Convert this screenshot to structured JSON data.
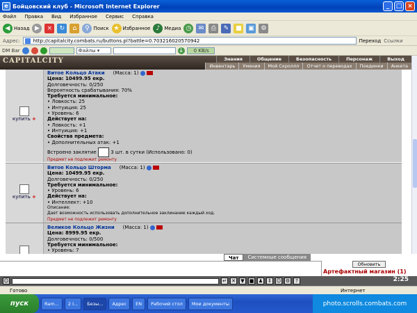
{
  "window": {
    "title": "Бойцовский клуб - Microsoft Internet Explorer"
  },
  "menu": [
    "Файл",
    "Правка",
    "Вид",
    "Избранное",
    "Сервис",
    "Справка"
  ],
  "toolbar": {
    "back": "Назад",
    "search": "Поиск",
    "favorites": "Избранное",
    "media": "Медиа"
  },
  "address": {
    "label": "Адрес:",
    "url": "http://capitalcity.combats.ru/buttons.pl?battle=0.703216020570942",
    "go": "Переход",
    "links": "Ссылки"
  },
  "dmbar": {
    "label": "DM Bar",
    "files": "Файлы",
    "progress": "0 KB/s"
  },
  "site": {
    "logo": "CAPITALCITY",
    "nav1": [
      "Знания",
      "Общение",
      "Безопасность",
      "Персонаж",
      "Выход"
    ],
    "nav2": [
      "Инвентарь",
      "Умения",
      "Мой Скроллл",
      "Отчет о переводах",
      "Поединки",
      "Анкета"
    ]
  },
  "items": [
    {
      "buy": "купить",
      "name": "Витое Кольцо Атаки",
      "mass": "(Масса: 1)",
      "price": "Цена: 10499.95 екр.",
      "durability": "Долговечность: 0/250",
      "lines": [
        {
          "t": "Вероятность срабатывания: 70%",
          "b": false
        },
        {
          "t": "Требуется минимальное:",
          "b": true
        },
        {
          "t": "• Ловкость: 25",
          "b": false
        },
        {
          "t": "• Интуиция: 25",
          "b": false
        },
        {
          "t": "• Уровень: 6",
          "b": false
        },
        {
          "t": "Действует на:",
          "b": true
        },
        {
          "t": "• Ловкость: +1",
          "b": false
        },
        {
          "t": "• Интуиция: +1",
          "b": false
        },
        {
          "t": "Свойства предмета:",
          "b": true
        },
        {
          "t": "• Дополнительных атак: +1",
          "b": false
        }
      ],
      "spell_prefix": "Встроено заклятие",
      "spell_suffix": "3 шт. в сутки (Использовано: 0)",
      "warning": "Предмет не подлежит ремонту"
    },
    {
      "buy": "купить",
      "name": "Витое Кольцо Шторма",
      "mass": "(Масса: 1)",
      "price": "Цена: 10499.95 екр.",
      "durability": "Долговечность: 0/250",
      "lines": [
        {
          "t": "Требуется минимальное:",
          "b": true
        },
        {
          "t": "• Уровень: 6",
          "b": false
        },
        {
          "t": "Действует на:",
          "b": true
        },
        {
          "t": "• Интеллект: +10",
          "b": false
        },
        {
          "t": "Описание:",
          "b": false
        },
        {
          "t": "Дает возможность использовать дополнительное заклинание каждый ход.",
          "b": false
        }
      ],
      "warning": "Предмет не подлежит ремонту"
    },
    {
      "name": "Великое Кольцо Жизни",
      "mass": "(Масса: 1)",
      "price": "Цена: 8999.95 екр.",
      "durability": "Долговечность: 0/500",
      "lines": [
        {
          "t": "Требуется минимальное:",
          "b": true
        },
        {
          "t": "• Уровень: 7",
          "b": false
        }
      ]
    }
  ],
  "chat": {
    "tab_chat": "Чат",
    "tab_system": "Системные сообщения",
    "refresh": "Обновить",
    "shop": "Артефактный магазин (1)",
    "clock": "2:25"
  },
  "status": {
    "left": "Готово",
    "right": "Интернет"
  },
  "taskbar": {
    "start": "пуск",
    "tasks": [
      "Ram...",
      "2 I...",
      "Безы...",
      "Адрес",
      "EN",
      "Рабочий стол",
      "Мои документы"
    ],
    "tray": "photo.scrolls.combats.com"
  }
}
